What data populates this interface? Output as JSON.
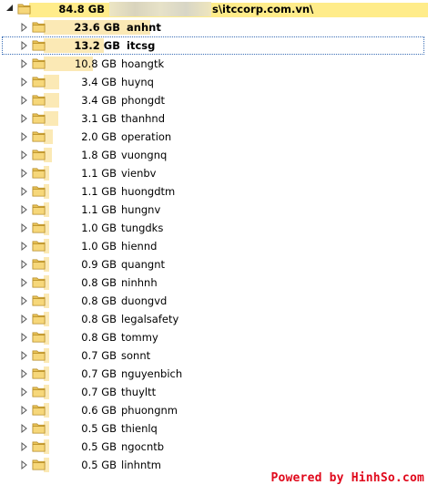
{
  "root": {
    "size": "84.8 GB",
    "path_suffix": "s\\itccorp.com.vn\\",
    "fill": 1.0
  },
  "items": [
    {
      "size": "23.6 GB",
      "name": "anhnt",
      "fill": 0.278,
      "bold": true
    },
    {
      "size": "13.2 GB",
      "name": "itcsg",
      "fill": 0.156,
      "bold": true,
      "focused": true
    },
    {
      "size": "10.8 GB",
      "name": "hoangtk",
      "fill": 0.127
    },
    {
      "size": "3.4 GB",
      "name": "huynq",
      "fill": 0.04
    },
    {
      "size": "3.4 GB",
      "name": "phongdt",
      "fill": 0.04
    },
    {
      "size": "3.1 GB",
      "name": "thanhnd",
      "fill": 0.037
    },
    {
      "size": "2.0 GB",
      "name": "operation",
      "fill": 0.024
    },
    {
      "size": "1.8 GB",
      "name": "vuongnq",
      "fill": 0.021
    },
    {
      "size": "1.1 GB",
      "name": "vienbv",
      "fill": 0.013
    },
    {
      "size": "1.1 GB",
      "name": "huongdtm",
      "fill": 0.013
    },
    {
      "size": "1.1 GB",
      "name": "hungnv",
      "fill": 0.013
    },
    {
      "size": "1.0 GB",
      "name": "tungdks",
      "fill": 0.012
    },
    {
      "size": "1.0 GB",
      "name": "hiennd",
      "fill": 0.012
    },
    {
      "size": "0.9 GB",
      "name": "quangnt",
      "fill": 0.011
    },
    {
      "size": "0.8 GB",
      "name": "ninhnh",
      "fill": 0.009
    },
    {
      "size": "0.8 GB",
      "name": "duongvd",
      "fill": 0.009
    },
    {
      "size": "0.8 GB",
      "name": "legalsafety",
      "fill": 0.009
    },
    {
      "size": "0.8 GB",
      "name": "tommy",
      "fill": 0.009
    },
    {
      "size": "0.7 GB",
      "name": "sonnt",
      "fill": 0.008
    },
    {
      "size": "0.7 GB",
      "name": "nguyenbich",
      "fill": 0.008
    },
    {
      "size": "0.7 GB",
      "name": "thuyltt",
      "fill": 0.008
    },
    {
      "size": "0.6 GB",
      "name": "phuongnm",
      "fill": 0.007
    },
    {
      "size": "0.5 GB",
      "name": "thienlq",
      "fill": 0.006
    },
    {
      "size": "0.5 GB",
      "name": "ngocntb",
      "fill": 0.006
    },
    {
      "size": "0.5 GB",
      "name": "linhntm",
      "fill": 0.006
    }
  ],
  "watermark": "Powered by HinhSo.com",
  "colors": {
    "bar_root": "#ffec8a",
    "bar_item": "#fbe9b5",
    "focus": "#3c6fb6",
    "watermark": "#e0081b"
  },
  "icons": {
    "expand": "triangle-right-icon",
    "collapse": "triangle-down-icon",
    "folder": "folder-icon"
  }
}
